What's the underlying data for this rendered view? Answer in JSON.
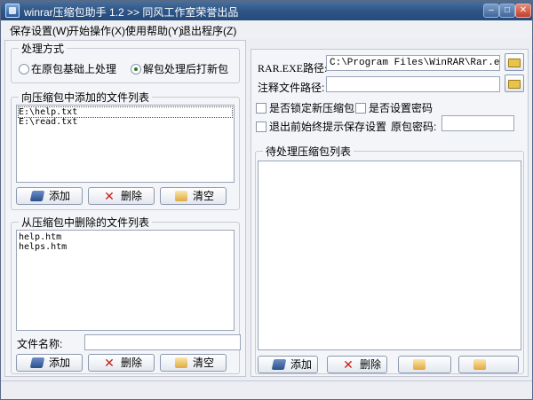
{
  "window": {
    "title": "winrar压缩包助手 1.2  >> 同风工作室荣誉出品"
  },
  "menu": [
    {
      "label": "保存设置(W)"
    },
    {
      "label": "开始操作(X)"
    },
    {
      "label": "使用帮助(Y)"
    },
    {
      "label": "退出程序(Z)"
    }
  ],
  "mode": {
    "title": "处理方式",
    "options": [
      "在原包基础上处理",
      "解包处理后打新包"
    ],
    "selected": "解包处理后打新包"
  },
  "add_list": {
    "title": "向压缩包中添加的文件列表",
    "items": [
      "E:\\help.txt",
      "E:\\read.txt"
    ],
    "buttons": {
      "add": "添加",
      "delete": "删除",
      "clear": "清空"
    }
  },
  "delete_list": {
    "title": "从压缩包中删除的文件列表",
    "items": [
      "help.htm",
      "helps.htm"
    ],
    "filename_label": "文件名称:",
    "filename_value": "",
    "buttons": {
      "add": "添加",
      "delete": "删除",
      "clear": "清空"
    }
  },
  "settings": {
    "rar_path_label": "RAR.EXE路径:",
    "rar_path_value": "C:\\Program Files\\WinRAR\\Rar.exe",
    "comment_label": "注释文件路径:",
    "comment_value": "",
    "lock_label": "是否锁定新压缩包",
    "password_label": "是否设置密码",
    "prompt_label": "退出前始终提示保存设置",
    "orig_password_label": "原包密码:",
    "orig_password_value": ""
  },
  "pending": {
    "title": "待处理压缩包列表",
    "items": [],
    "buttons": {
      "add": "添加",
      "delete": "删除"
    }
  }
}
